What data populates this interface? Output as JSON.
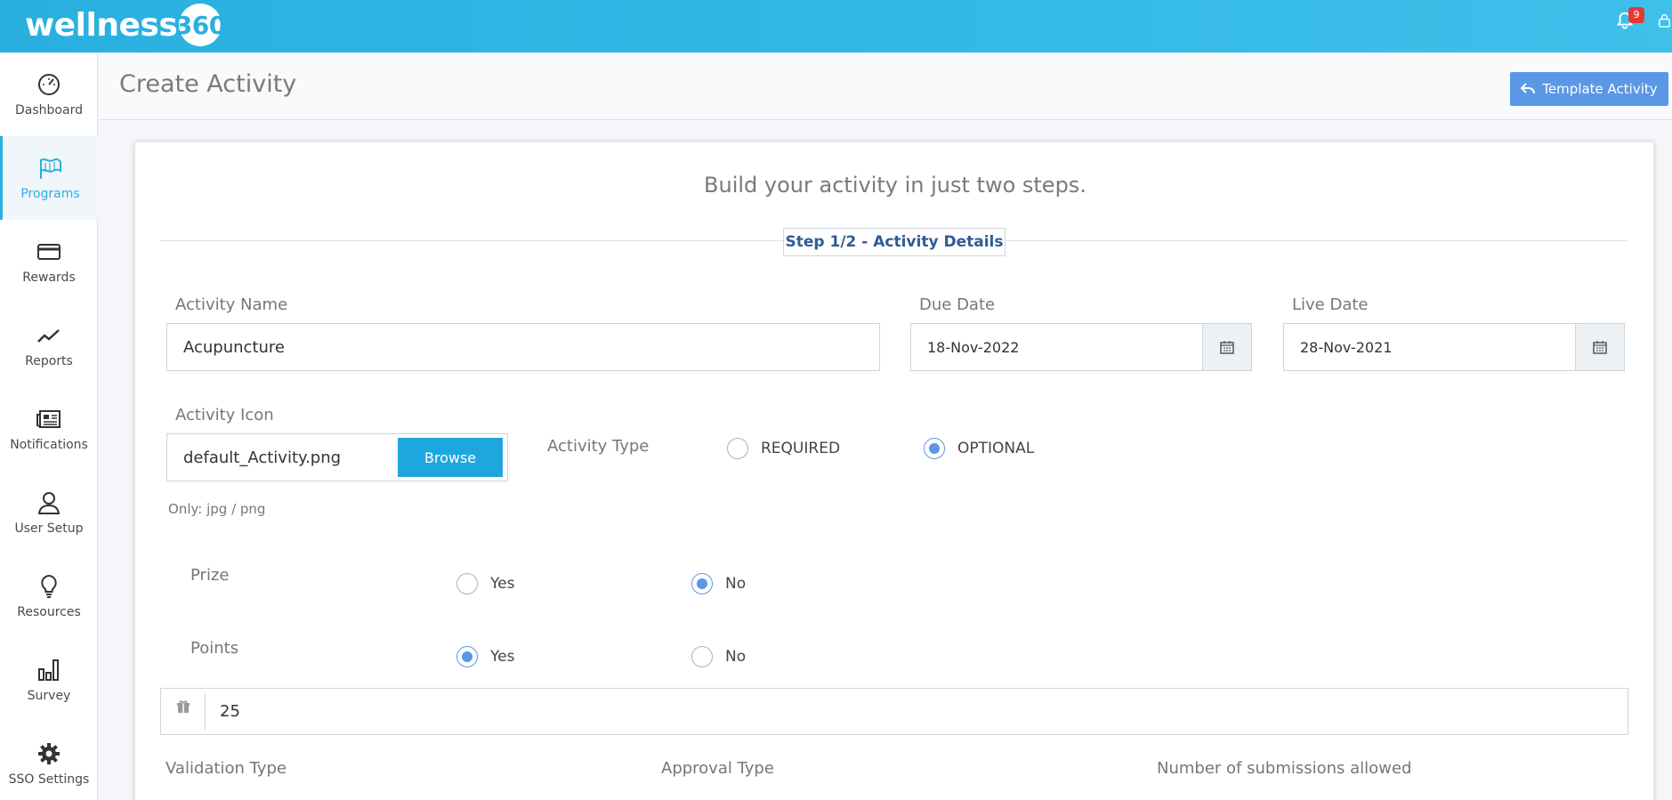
{
  "app": {
    "logo_text": "wellness",
    "logo_number": "360",
    "notification_count": "9"
  },
  "sidebar": {
    "items": [
      {
        "label": "Dashboard",
        "icon": "gauge-icon"
      },
      {
        "label": "Programs",
        "icon": "flags-icon",
        "active": true
      },
      {
        "label": "Rewards",
        "icon": "card-icon"
      },
      {
        "label": "Reports",
        "icon": "trend-icon"
      },
      {
        "label": "Notifications",
        "icon": "newspaper-icon"
      },
      {
        "label": "User Setup",
        "icon": "user-icon"
      },
      {
        "label": "Resources",
        "icon": "bulb-icon"
      },
      {
        "label": "Survey",
        "icon": "bar-chart-icon"
      },
      {
        "label": "SSO Settings",
        "icon": "gear-icon"
      }
    ]
  },
  "header": {
    "title": "Create Activity",
    "template_button": "Template Activity"
  },
  "form": {
    "intro": "Build your activity in just two steps.",
    "step_label": "Step 1/2 - Activity Details",
    "activity_name": {
      "label": "Activity Name",
      "value": "Acupuncture"
    },
    "due_date": {
      "label": "Due Date",
      "value": "18-Nov-2022"
    },
    "live_date": {
      "label": "Live Date",
      "value": "28-Nov-2021"
    },
    "activity_icon": {
      "label": "Activity Icon",
      "value": "default_Activity.png",
      "browse": "Browse",
      "hint": "Only: jpg / png"
    },
    "activity_type": {
      "label": "Activity Type",
      "options": [
        "REQUIRED",
        "OPTIONAL"
      ],
      "selected": "OPTIONAL"
    },
    "prize": {
      "label": "Prize",
      "options": [
        "Yes",
        "No"
      ],
      "selected": "No"
    },
    "points": {
      "label": "Points",
      "options": [
        "Yes",
        "No"
      ],
      "selected": "Yes",
      "value": "25"
    },
    "validation_type": {
      "label": "Validation Type"
    },
    "approval_type": {
      "label": "Approval Type"
    },
    "submissions": {
      "label": "Number of submissions allowed"
    }
  },
  "colors": {
    "topbar": "#29b0e0",
    "accent": "#5a97e6",
    "browse": "#1ea7de"
  }
}
